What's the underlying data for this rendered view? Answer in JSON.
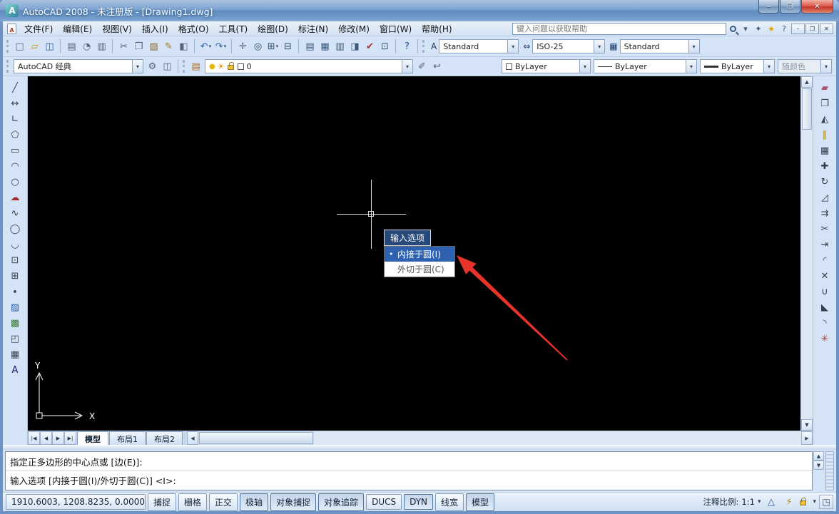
{
  "ui": {
    "dropdown_arrow": "▾"
  },
  "window": {
    "title": "AutoCAD 2008 - 未注册版 - [Drawing1.dwg]",
    "icon_glyph": "A",
    "controls": {
      "minimize": "–",
      "maximize": "❐",
      "close": "✕"
    }
  },
  "menubar": {
    "items": [
      "文件(F)",
      "编辑(E)",
      "视图(V)",
      "插入(I)",
      "格式(O)",
      "工具(T)",
      "绘图(D)",
      "标注(N)",
      "修改(M)",
      "窗口(W)",
      "帮助(H)"
    ],
    "search_placeholder": "键入问题以获取帮助",
    "icon_comm": "✦",
    "icon_favorites": "★",
    "icon_help": "?",
    "mdi": {
      "minimize": "–",
      "restore": "❐",
      "close": "✕"
    }
  },
  "toolbar_std": [
    {
      "name": "qnew",
      "glyph": "□",
      "color": "#56667a"
    },
    {
      "name": "open",
      "glyph": "▱",
      "color": "#c79100"
    },
    {
      "name": "save",
      "glyph": "◫",
      "color": "#2d5fa8"
    },
    {
      "sep": true
    },
    {
      "name": "plot",
      "glyph": "▤",
      "color": "#56667a"
    },
    {
      "name": "plot-preview",
      "glyph": "◔",
      "color": "#56667a"
    },
    {
      "name": "publish",
      "glyph": "▥",
      "color": "#56667a"
    },
    {
      "sep": true
    },
    {
      "name": "cut",
      "glyph": "✂",
      "color": "#56667a"
    },
    {
      "name": "copy-clip",
      "glyph": "❐",
      "color": "#56667a"
    },
    {
      "name": "paste",
      "glyph": "▨",
      "color": "#8a6a2a"
    },
    {
      "name": "match-properties",
      "glyph": "✎",
      "color": "#a8781e"
    },
    {
      "name": "block-editor",
      "glyph": "◧",
      "color": "#56667a"
    },
    {
      "sep": true
    },
    {
      "name": "undo",
      "glyph": "↶",
      "color": "#2d5fa8",
      "dd": true
    },
    {
      "name": "redo",
      "glyph": "↷",
      "color": "#2d5fa8",
      "dd": true
    },
    {
      "sep": true
    },
    {
      "name": "pan",
      "glyph": "✛",
      "color": "#56667a"
    },
    {
      "name": "zoom-realtime",
      "glyph": "◎",
      "color": "#2f4f6f"
    },
    {
      "name": "zoom-window",
      "glyph": "⊞",
      "color": "#2f4f6f",
      "dd": true
    },
    {
      "name": "zoom-previous",
      "glyph": "⊟",
      "color": "#2f4f6f"
    },
    {
      "sep": true
    },
    {
      "name": "properties",
      "glyph": "▤",
      "color": "#3a5a7a"
    },
    {
      "name": "designcenter",
      "glyph": "▦",
      "color": "#3a5a7a"
    },
    {
      "name": "tool-palettes",
      "glyph": "▥",
      "color": "#3a5a7a"
    },
    {
      "name": "sheet-set-manager",
      "glyph": "◨",
      "color": "#3a5a7a"
    },
    {
      "name": "markup-set-manager",
      "glyph": "✔",
      "color": "#a03030"
    },
    {
      "name": "quickcalc",
      "glyph": "⊡",
      "color": "#3a5a7a"
    },
    {
      "sep": true
    },
    {
      "name": "help",
      "glyph": "?",
      "color": "#1a4e9a"
    }
  ],
  "styles": {
    "icon_text": "A",
    "icon_dim": "⇔",
    "icon_table": "▦",
    "text_style": "Standard",
    "dim_style": "ISO-25",
    "table_style": "Standard"
  },
  "workspace_icons": [
    {
      "name": "workspace-settings",
      "glyph": "⚙",
      "color": "#56667a"
    },
    {
      "name": "save-workspace",
      "glyph": "◫",
      "color": "#56667a"
    }
  ],
  "layer_icons": [
    {
      "name": "layer-properties-manager",
      "glyph": "▤",
      "color": "#b06a1e"
    }
  ],
  "layer_icons2": [
    {
      "name": "make-object-layer-current",
      "glyph": "✐",
      "color": "#56667a"
    },
    {
      "name": "layer-previous",
      "glyph": "↩",
      "color": "#56667a"
    }
  ],
  "layers": {
    "workspace": "AutoCAD 经典",
    "bulb": "●",
    "sun": "☀",
    "current_layer": "0"
  },
  "props": {
    "color": "ByLayer",
    "linetype": "ByLayer",
    "lineweight": "ByLayer",
    "plot_style": "随颜色"
  },
  "draw_tools": [
    {
      "name": "line",
      "glyph": "╱",
      "color": "#33404f"
    },
    {
      "name": "construction-line",
      "glyph": "↔",
      "color": "#33404f"
    },
    {
      "name": "polyline",
      "glyph": "∟",
      "color": "#33404f"
    },
    {
      "name": "polygon",
      "glyph": "⬠",
      "color": "#33404f"
    },
    {
      "name": "rectangle",
      "glyph": "▭",
      "color": "#33404f"
    },
    {
      "name": "arc",
      "glyph": "◠",
      "color": "#33404f"
    },
    {
      "name": "circle",
      "glyph": "○",
      "color": "#33404f"
    },
    {
      "name": "revision-cloud",
      "glyph": "☁",
      "color": "#a03030"
    },
    {
      "name": "spline",
      "glyph": "∿",
      "color": "#33404f"
    },
    {
      "name": "ellipse",
      "glyph": "◯",
      "color": "#33404f"
    },
    {
      "name": "ellipse-arc",
      "glyph": "◡",
      "color": "#33404f"
    },
    {
      "name": "insert-block",
      "glyph": "⊡",
      "color": "#33404f"
    },
    {
      "name": "make-block",
      "glyph": "⊞",
      "color": "#33404f"
    },
    {
      "name": "point",
      "glyph": "∙",
      "color": "#33404f"
    },
    {
      "name": "hatch",
      "glyph": "▨",
      "color": "#2d5fa8"
    },
    {
      "name": "gradient",
      "glyph": "▩",
      "color": "#3a7a3a"
    },
    {
      "name": "region",
      "glyph": "◰",
      "color": "#33404f"
    },
    {
      "name": "table",
      "glyph": "▦",
      "color": "#33404f"
    },
    {
      "name": "multiline-text",
      "glyph": "A",
      "color": "#1a1a6a"
    }
  ],
  "modify_tools": [
    {
      "name": "erase",
      "glyph": "▰",
      "color": "#b05070"
    },
    {
      "name": "copy-object",
      "glyph": "❐",
      "color": "#33404f"
    },
    {
      "name": "mirror",
      "glyph": "◭",
      "color": "#33404f"
    },
    {
      "name": "offset",
      "glyph": "∥",
      "color": "#b08800"
    },
    {
      "name": "array",
      "glyph": "▦",
      "color": "#33404f"
    },
    {
      "name": "move",
      "glyph": "✚",
      "color": "#33404f"
    },
    {
      "name": "rotate",
      "glyph": "↻",
      "color": "#33404f"
    },
    {
      "name": "scale",
      "glyph": "◿",
      "color": "#33404f"
    },
    {
      "name": "stretch",
      "glyph": "⇉",
      "color": "#33404f"
    },
    {
      "name": "trim",
      "glyph": "✂",
      "color": "#33404f"
    },
    {
      "name": "extend",
      "glyph": "⇥",
      "color": "#33404f"
    },
    {
      "name": "break-at-point",
      "glyph": "◜",
      "color": "#33404f"
    },
    {
      "name": "break",
      "glyph": "✕",
      "color": "#33404f"
    },
    {
      "name": "join",
      "glyph": "∪",
      "color": "#33404f"
    },
    {
      "name": "chamfer",
      "glyph": "◣",
      "color": "#33404f"
    },
    {
      "name": "fillet",
      "glyph": "◝",
      "color": "#33404f"
    },
    {
      "name": "explode",
      "glyph": "✳",
      "color": "#b04030"
    }
  ],
  "canvas": {
    "tooltip": "输入选项",
    "marker": "•",
    "options": [
      {
        "label": "内接于圆(I)",
        "selected": true
      },
      {
        "label": "外切于圆(C)",
        "selected": false
      }
    ],
    "ucs_x": "X",
    "ucs_y": "Y",
    "arrow_color": "#e8332a"
  },
  "scroll": {
    "up": "▲",
    "down": "▼",
    "left": "◀",
    "right": "▶"
  },
  "tabs": {
    "nav": [
      "|◀",
      "◀",
      "▶",
      "▶|"
    ],
    "items": [
      {
        "label": "模型",
        "active": true
      },
      {
        "label": "布局1",
        "active": false
      },
      {
        "label": "布局2",
        "active": false
      }
    ]
  },
  "command": {
    "lines": [
      "指定正多边形的中心点或 [边(E)]:",
      "输入选项 [内接于圆(I)/外切于圆(C)] <I>:"
    ]
  },
  "status": {
    "coords": "1910.6003, 1208.8235, 0.0000",
    "toggles": [
      {
        "id": "snap",
        "label": "捕捉",
        "active": false
      },
      {
        "id": "grid",
        "label": "栅格",
        "active": false
      },
      {
        "id": "ortho",
        "label": "正交",
        "active": false
      },
      {
        "id": "polar",
        "label": "极轴",
        "active": true
      },
      {
        "id": "osnap",
        "label": "对象捕捉",
        "active": true
      },
      {
        "id": "otrack",
        "label": "对象追踪",
        "active": true
      },
      {
        "id": "ducs",
        "label": "DUCS",
        "active": false
      },
      {
        "id": "dyn",
        "label": "DYN",
        "active": true
      },
      {
        "id": "lineweight",
        "label": "线宽",
        "active": false
      },
      {
        "id": "model",
        "label": "模型",
        "active": true
      }
    ],
    "scale_label": "注释比例:",
    "scale_value": "1:1",
    "icons": [
      {
        "name": "annotation-visibility",
        "glyph": "△",
        "color": "#2d5fa8"
      },
      {
        "name": "annotation-autoscale",
        "glyph": "⚡",
        "color": "#b08800"
      }
    ],
    "clean": "◳"
  }
}
